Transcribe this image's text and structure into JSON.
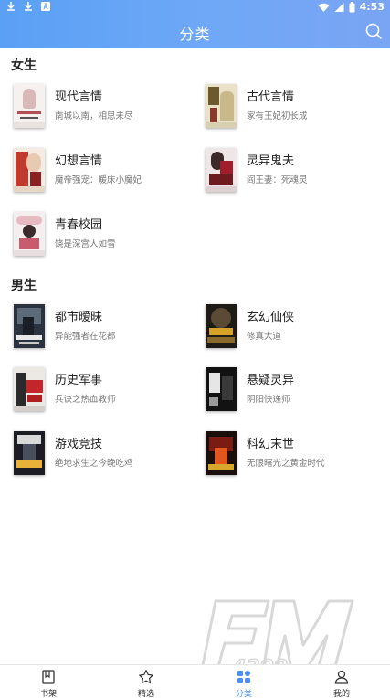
{
  "status": {
    "time": "4:53"
  },
  "header": {
    "title": "分类"
  },
  "sections": [
    {
      "title": "女生",
      "items": [
        {
          "name": "现代言情",
          "sub": "南城以南，相思未尽"
        },
        {
          "name": "古代言情",
          "sub": "家有王妃初长成"
        },
        {
          "name": "幻想言情",
          "sub": "魔帝强宠：暖床小魔妃"
        },
        {
          "name": "灵异鬼夫",
          "sub": "阎王妻：死魂灵"
        },
        {
          "name": "青春校园",
          "sub": "饶是深宫人如雪"
        }
      ]
    },
    {
      "title": "男生",
      "items": [
        {
          "name": "都市暧昧",
          "sub": "异能强者在花都"
        },
        {
          "name": "玄幻仙侠",
          "sub": "修真大道"
        },
        {
          "name": "历史军事",
          "sub": "兵诀之热血教师"
        },
        {
          "name": "悬疑灵异",
          "sub": "阴阳快递师"
        },
        {
          "name": "游戏竞技",
          "sub": "绝地求生之今晚吃鸡"
        },
        {
          "name": "科幻末世",
          "sub": "无限曙光之黄金时代"
        }
      ]
    }
  ],
  "tabs": [
    {
      "label": "书架",
      "icon": "bookshelf-icon"
    },
    {
      "label": "精选",
      "icon": "star-icon"
    },
    {
      "label": "分类",
      "icon": "category-icon"
    },
    {
      "label": "我的",
      "icon": "profile-icon"
    }
  ],
  "active_tab": 2,
  "colors": {
    "accent": "#4a8ff2",
    "header_start": "#5aa0f5",
    "header_end": "#7aa4f4"
  }
}
